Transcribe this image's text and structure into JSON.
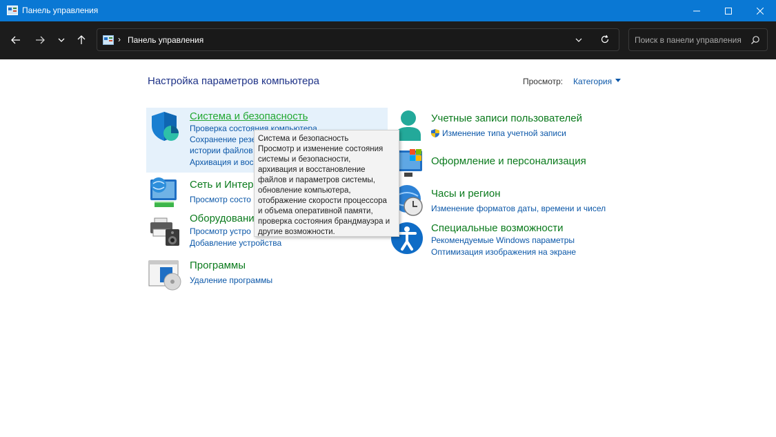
{
  "window": {
    "title": "Панель управления"
  },
  "address": {
    "path": "Панель управления",
    "separator": "›"
  },
  "search": {
    "placeholder": "Поиск в панели управления"
  },
  "page": {
    "heading": "Настройка параметров компьютера",
    "view_label": "Просмотр:",
    "view_value": "Категория"
  },
  "left": [
    {
      "title": "Система и безопасность",
      "links": [
        "Проверка состояния компьютера",
        "Сохранение резе",
        "истории файлов",
        "Архивация и вос"
      ]
    },
    {
      "title": "Сеть и Интер",
      "links": [
        "Просмотр состо"
      ]
    },
    {
      "title": "Оборудовани",
      "links": [
        "Просмотр устро",
        "Добавление устройства"
      ]
    },
    {
      "title": "Программы",
      "links": [
        "Удаление программы"
      ]
    }
  ],
  "right": [
    {
      "title": "Учетные записи пользователей",
      "links": [
        "Изменение типа учетной записи"
      ]
    },
    {
      "title": "Оформление и персонализация",
      "links": []
    },
    {
      "title": "Часы и регион",
      "links": [
        "Изменение форматов даты, времени и чисел"
      ]
    },
    {
      "title": "Специальные возможности",
      "links": [
        "Рекомендуемые Windows параметры",
        "Оптимизация изображения на экране"
      ]
    }
  ],
  "tooltip": {
    "lines": [
      "Система и безопасность",
      "Просмотр и изменение состояния",
      "системы и безопасности,",
      "архивация и восстановление",
      "файлов и параметров системы,",
      "обновление компьютера,",
      "отображение скорости процессора",
      "и объема оперативной памяти,",
      "проверка состояния брандмауэра и",
      "другие возможности."
    ]
  },
  "colors": {
    "titlebar": "#0a78d4",
    "navbar": "#1c1c1c",
    "category": "#0a7a1c",
    "link": "#0b57a8"
  }
}
